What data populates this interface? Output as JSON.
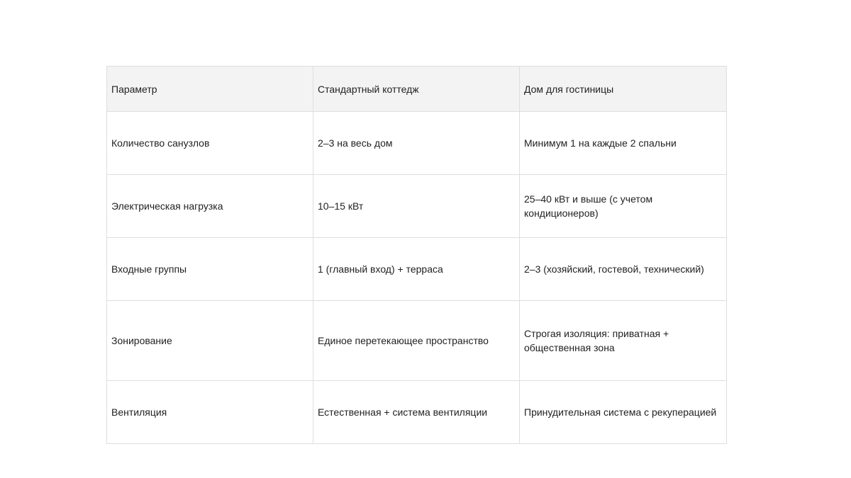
{
  "table": {
    "headers": [
      "Параметр",
      "Стандартный коттедж",
      "Дом для гостиницы"
    ],
    "rows": [
      [
        "Количество санузлов",
        "2–3 на весь дом",
        "Минимум 1 на каждые 2 спальни"
      ],
      [
        "Электрическая нагрузка",
        "10–15 кВт",
        "25–40 кВт и выше (с учетом кондиционеров)"
      ],
      [
        "Входные группы",
        "1 (главный вход) + терраса",
        "2–3 (хозяйский, гостевой, технический)"
      ],
      [
        "Зонирование",
        "Единое перетекающее пространство",
        "Строгая изоляция: приватная + общественная зона"
      ],
      [
        "Вентиляция",
        "Естественная + система вентиляции",
        "Принудительная система с рекуперацией"
      ]
    ]
  },
  "colors": {
    "header_background": "#f3f3f3",
    "border": "#dedede",
    "text": "#222222"
  }
}
